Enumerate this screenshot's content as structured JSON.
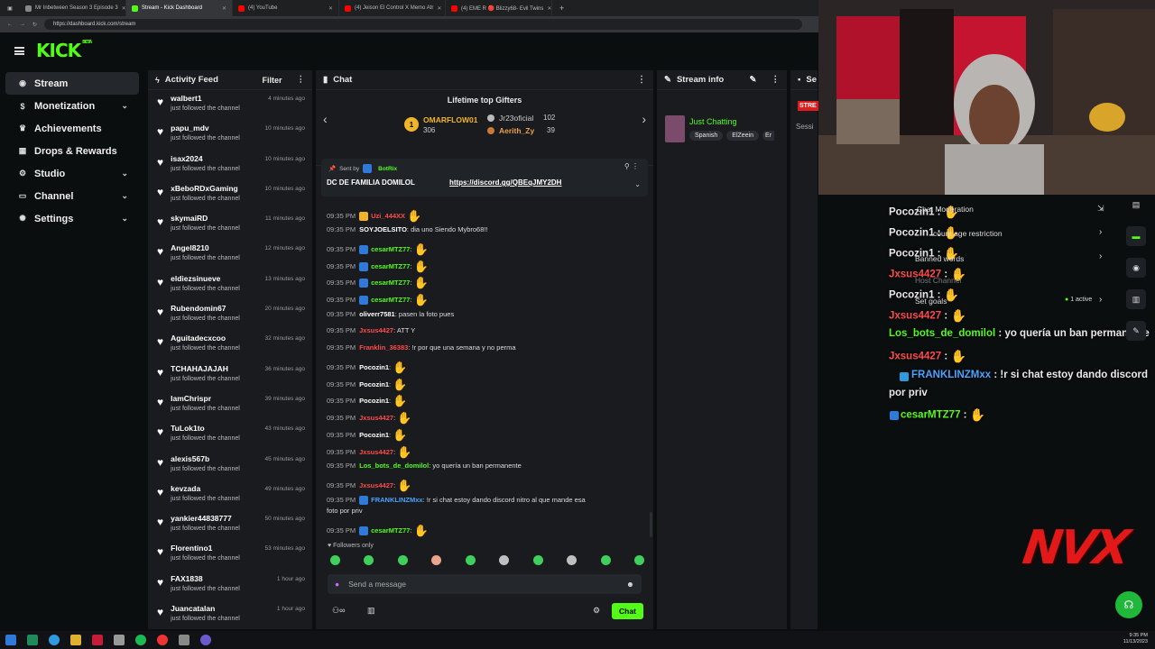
{
  "browser": {
    "tabs": [
      {
        "label": "Mr Inbetween Season 3 Episode 3",
        "fav": "tv-icon"
      },
      {
        "label": "Stream - Kick Dashboard",
        "fav": "kick-icon"
      },
      {
        "label": "(4) YouTube",
        "fav": "youtube-icon"
      },
      {
        "label": "(4) Jeison El Control X Memo Atr",
        "fav": "youtube-icon"
      },
      {
        "label": "(4) EME R 🔴 Blizzy68- Evil Twins",
        "fav": "youtube-icon"
      }
    ],
    "url": "https://dashboard.kick.com/stream"
  },
  "kick": {
    "logo": "KICK",
    "beta": "BETA"
  },
  "sidebar": {
    "items": [
      {
        "label": "Stream",
        "icon": "broadcast-icon",
        "chevron": false,
        "active": true
      },
      {
        "label": "Monetization",
        "icon": "money-icon",
        "chevron": true
      },
      {
        "label": "Achievements",
        "icon": "trophy-icon",
        "chevron": false
      },
      {
        "label": "Drops & Rewards",
        "icon": "gift-icon",
        "chevron": false
      },
      {
        "label": "Studio",
        "icon": "studio-icon",
        "chevron": true
      },
      {
        "label": "Channel",
        "icon": "channel-icon",
        "chevron": true
      },
      {
        "label": "Settings",
        "icon": "gear-icon",
        "chevron": true
      }
    ]
  },
  "activity": {
    "title": "Activity Feed",
    "filter": "Filter",
    "action": "just followed the channel",
    "items": [
      {
        "user": "walbert1",
        "time": "4 minutes ago"
      },
      {
        "user": "papu_mdv",
        "time": "10 minutes ago"
      },
      {
        "user": "isax2024",
        "time": "10 minutes ago"
      },
      {
        "user": "xBeboRDxGaming",
        "time": "10 minutes ago"
      },
      {
        "user": "skymaiRD",
        "time": "11 minutes ago"
      },
      {
        "user": "Angel8210",
        "time": "12 minutes ago"
      },
      {
        "user": "eldiezsinueve",
        "time": "13 minutes ago"
      },
      {
        "user": "Rubendomin67",
        "time": "20 minutes ago"
      },
      {
        "user": "Aguitadecxcoo",
        "time": "32 minutes ago"
      },
      {
        "user": "TCHAHAJAJAH",
        "time": "36 minutes ago"
      },
      {
        "user": "IamChrispr",
        "time": "39 minutes ago"
      },
      {
        "user": "TuLok1to",
        "time": "43 minutes ago"
      },
      {
        "user": "alexis567b",
        "time": "45 minutes ago"
      },
      {
        "user": "kevzada",
        "time": "49 minutes ago"
      },
      {
        "user": "yankier44838777",
        "time": "50 minutes ago"
      },
      {
        "user": "Florentino1",
        "time": "53 minutes ago"
      },
      {
        "user": "FAX1838",
        "time": "1 hour ago"
      },
      {
        "user": "Juancatalan",
        "time": "1 hour ago"
      }
    ]
  },
  "chat": {
    "title": "Chat",
    "gifters_title": "Lifetime top Gifters",
    "gifters": [
      {
        "name": "OMARFLOW01",
        "count": "306"
      },
      {
        "name": "Jr23oficial",
        "count": "102"
      },
      {
        "name": "Aerith_Zy",
        "count": "39"
      }
    ],
    "pinned": {
      "sent_by": "Sent by",
      "bot": "BotRix",
      "text": "DC DE FAMILIA DOMILOL",
      "link": "https://discord.gg/QBEqJMY2DH"
    },
    "messages": [
      {
        "time": "09:35 PM",
        "user": "Uzi_444XX",
        "color": "red",
        "text": ""
      },
      {
        "time": "09:35 PM",
        "user": "SOYJOELSITO",
        "color": "white",
        "text": ": dia uno Siendo Mybro68!!"
      },
      {
        "time": "09:35 PM",
        "user": "cesarMTZ77",
        "color": "green",
        "text": ":"
      },
      {
        "time": "09:35 PM",
        "user": "cesarMTZ77",
        "color": "green",
        "text": ":"
      },
      {
        "time": "09:35 PM",
        "user": "cesarMTZ77",
        "color": "green",
        "text": ":"
      },
      {
        "time": "09:35 PM",
        "user": "cesarMTZ77",
        "color": "green",
        "text": ":"
      },
      {
        "time": "09:35 PM",
        "user": "oliverr7581",
        "color": "white",
        "text": ": pasen la foto pues"
      },
      {
        "time": "09:35 PM",
        "user": "Jxsus4427",
        "color": "red",
        "text": ": ATT Y"
      },
      {
        "time": "09:35 PM",
        "user": "Franklin_36383",
        "color": "red",
        "text": ": !r por que una semana y no perma"
      },
      {
        "time": "09:35 PM",
        "user": "Pocozin1",
        "color": "white",
        "text": ":"
      },
      {
        "time": "09:35 PM",
        "user": "Pocozin1",
        "color": "white",
        "text": ":"
      },
      {
        "time": "09:35 PM",
        "user": "Pocozin1",
        "color": "white",
        "text": ":"
      },
      {
        "time": "09:35 PM",
        "user": "Jxsus4427",
        "color": "red",
        "text": ":"
      },
      {
        "time": "09:35 PM",
        "user": "Pocozin1",
        "color": "white",
        "text": ":"
      },
      {
        "time": "09:35 PM",
        "user": "Jxsus4427",
        "color": "red",
        "text": ":"
      },
      {
        "time": "09:35 PM",
        "user": "Los_bots_de_domilol",
        "color": "green",
        "text": ": yo quería un ban permanente"
      },
      {
        "time": "09:35 PM",
        "user": "Jxsus4427",
        "color": "red",
        "text": ":"
      },
      {
        "time": "09:35 PM",
        "user": "FRANKLINZMxx",
        "color": "blue",
        "text": ": !r si chat estoy dando discord nitro al que mande esa"
      },
      {
        "time": "09:35 PM",
        "user": "cesarMTZ77",
        "color": "green",
        "text": ":"
      }
    ],
    "wrap_line": "foto por priv",
    "followers_only": "Followers only",
    "placeholder": "Send a message",
    "send_label": "Chat"
  },
  "streaminfo": {
    "title": "Stream info",
    "category": "Just Chatting",
    "tags": [
      "Spanish",
      "ElZeein",
      "Er"
    ]
  },
  "sessions": {
    "title": "Se",
    "badge": "STRE",
    "label": "Sessi"
  },
  "overlay": {
    "lines": [
      {
        "user": "Pocozin1",
        "color": "white",
        "text": " :"
      },
      {
        "user": "Pocozin1",
        "color": "white",
        "text": " :"
      },
      {
        "user": "Pocozin1",
        "color": "white",
        "text": " :"
      },
      {
        "user": "Jxsus4427",
        "color": "red",
        "text": " :"
      },
      {
        "user": "Pocozin1",
        "color": "white",
        "text": " :"
      },
      {
        "user": "Jxsus4427",
        "color": "red",
        "text": " :"
      },
      {
        "user": "Los_bots_de_domilol",
        "color": "green",
        "text": " : yo quería un ban permanente"
      },
      {
        "user": "Jxsus4427",
        "color": "red",
        "text": " :"
      },
      {
        "user": "FRANKLINZMxx",
        "color": "blue",
        "text": " : !r si chat estoy dando discord"
      },
      {
        "user": "",
        "color": "white",
        "text": "por priv"
      },
      {
        "user": "cesarMTZ77",
        "color": "green",
        "text": " :"
      }
    ],
    "under": {
      "moderation": "Chat Moderation",
      "restriction": "count age restriction",
      "banned": "Banned words",
      "host": "Host Channel",
      "goals": "Set goals",
      "active": "1 active"
    },
    "logo": "NVX"
  },
  "taskbar": {
    "time": "9:35 PM",
    "date": "11/13/2023"
  },
  "colors": {
    "kick_green": "#53fc18",
    "red": "#ff4b4b",
    "blue": "#4aa3ff"
  }
}
